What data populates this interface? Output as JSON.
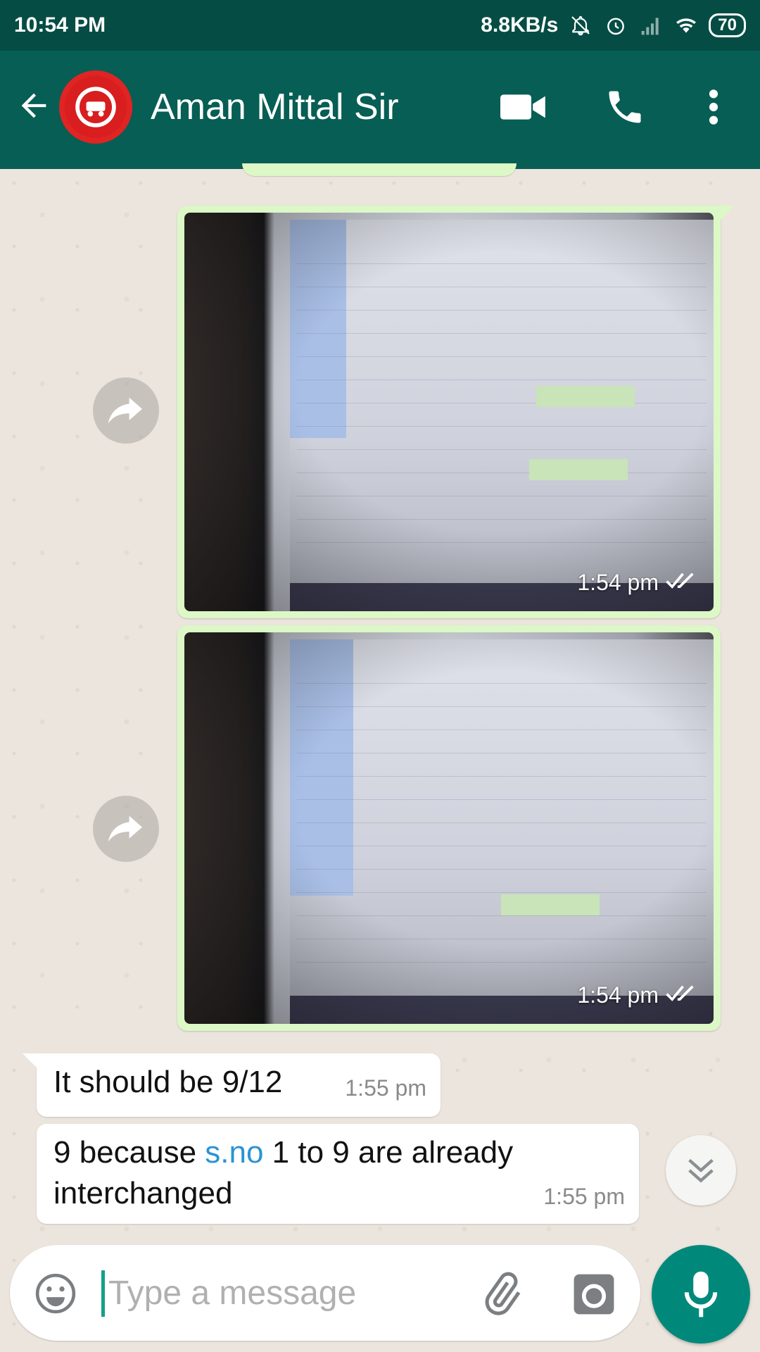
{
  "status_bar": {
    "time": "10:54 PM",
    "net_speed": "8.8KB/s",
    "battery": "70",
    "icons": [
      "mute-bell-icon",
      "alarm-icon",
      "signal-icon",
      "wifi-icon",
      "battery-icon"
    ]
  },
  "header": {
    "contact_name": "Aman Mittal Sir",
    "avatar": "indian-railways-logo",
    "actions": [
      "back-arrow-icon",
      "video-call-icon",
      "phone-icon",
      "more-vert-icon"
    ]
  },
  "messages": [
    {
      "type": "image",
      "direction": "outgoing",
      "time": "1:54 pm",
      "status": "read"
    },
    {
      "type": "image",
      "direction": "outgoing",
      "time": "1:54 pm",
      "status": "read"
    },
    {
      "type": "text",
      "direction": "incoming",
      "text": "It should be 9/12",
      "time": "1:55 pm"
    },
    {
      "type": "text",
      "direction": "incoming",
      "text_before": "9 because ",
      "link": "s.no",
      "text_after": " 1 to 9 are already interchanged",
      "time": "1:55 pm"
    }
  ],
  "composer": {
    "placeholder": "Type a message",
    "value": ""
  },
  "colors": {
    "status_bar": "#054d44",
    "app_bar": "#075e54",
    "outgoing_bubble": "#dcf8c6",
    "incoming_bubble": "#ffffff",
    "mic_button": "#00897b",
    "link": "#2b93d4"
  }
}
